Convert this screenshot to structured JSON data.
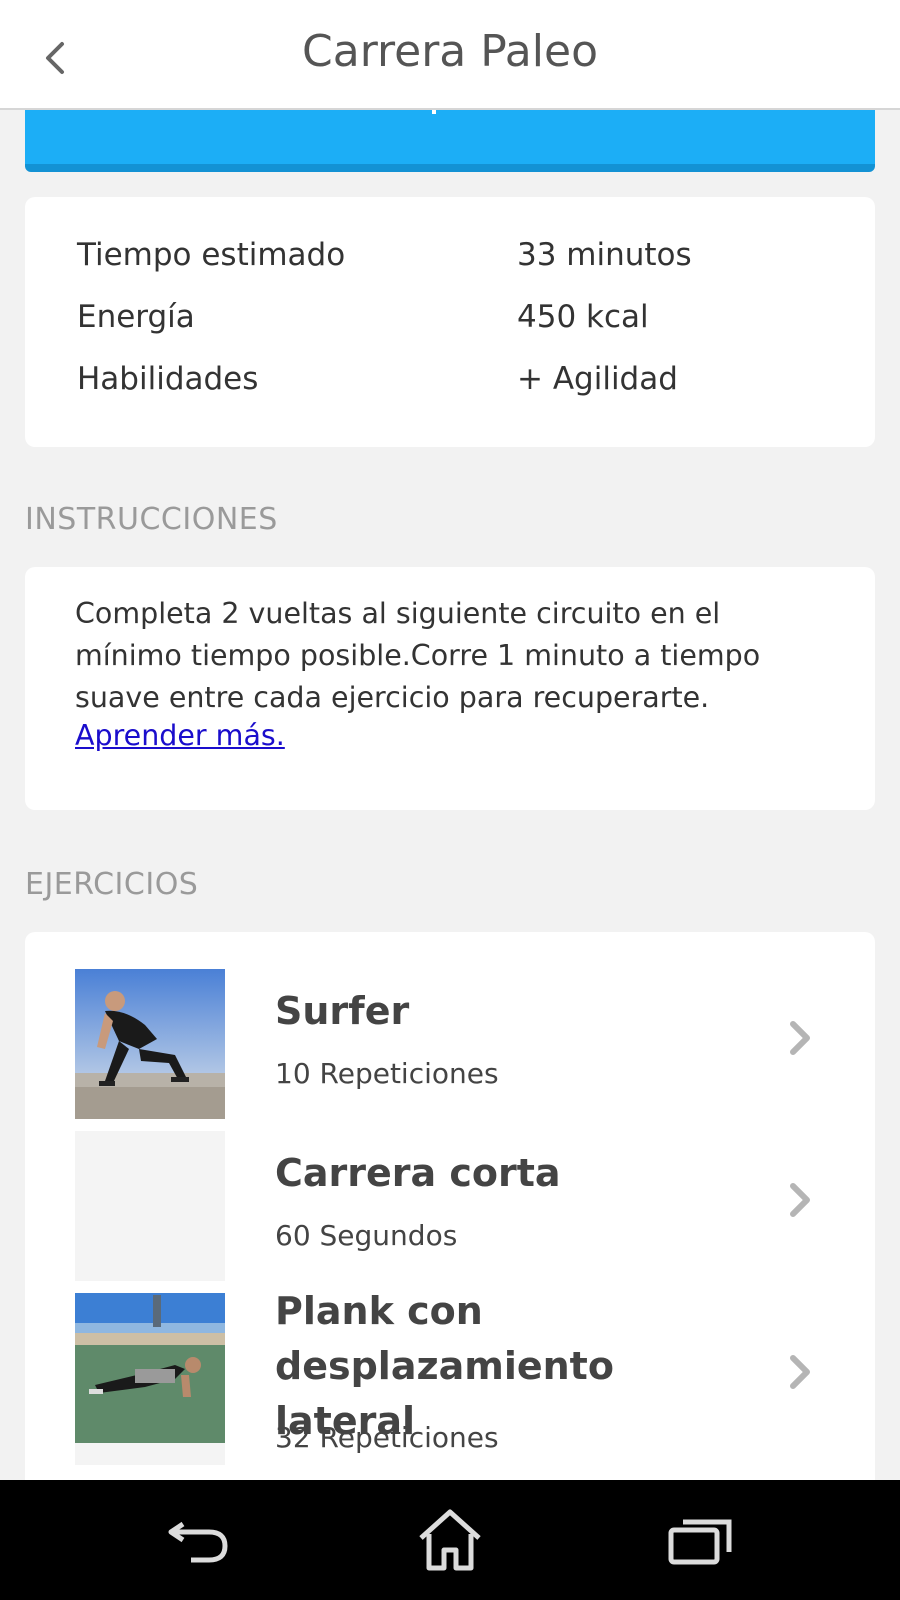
{
  "header": {
    "title": "Carrera Paleo"
  },
  "stats": [
    {
      "label": "Tiempo estimado",
      "value": "33 minutos"
    },
    {
      "label": "Energía",
      "value": "450 kcal"
    },
    {
      "label": "Habilidades",
      "value": "+ Agilidad"
    }
  ],
  "instructions": {
    "heading": "INSTRUCCIONES",
    "text": "Completa 2 vueltas al siguiente circuito en el mínimo tiempo posible.Corre 1 minuto a tiempo suave entre cada ejercicio para recuperarte.",
    "link": "Aprender más."
  },
  "exercises": {
    "heading": "EJERCICIOS",
    "items": [
      {
        "name": "Surfer",
        "detail": "10 Repeticiones"
      },
      {
        "name": "Carrera corta",
        "detail": "60 Segundos"
      },
      {
        "name": "Plank con desplazamiento lateral",
        "detail": "32 Repeticiones"
      }
    ]
  },
  "colors": {
    "accent": "#1caef6",
    "link": "#1a0dcc",
    "background": "#f2f2f2"
  },
  "icons": {
    "back": "chevron-left-icon",
    "item": "chevron-right-icon",
    "nav": [
      "back-arrow-icon",
      "home-icon",
      "recent-apps-icon"
    ]
  }
}
